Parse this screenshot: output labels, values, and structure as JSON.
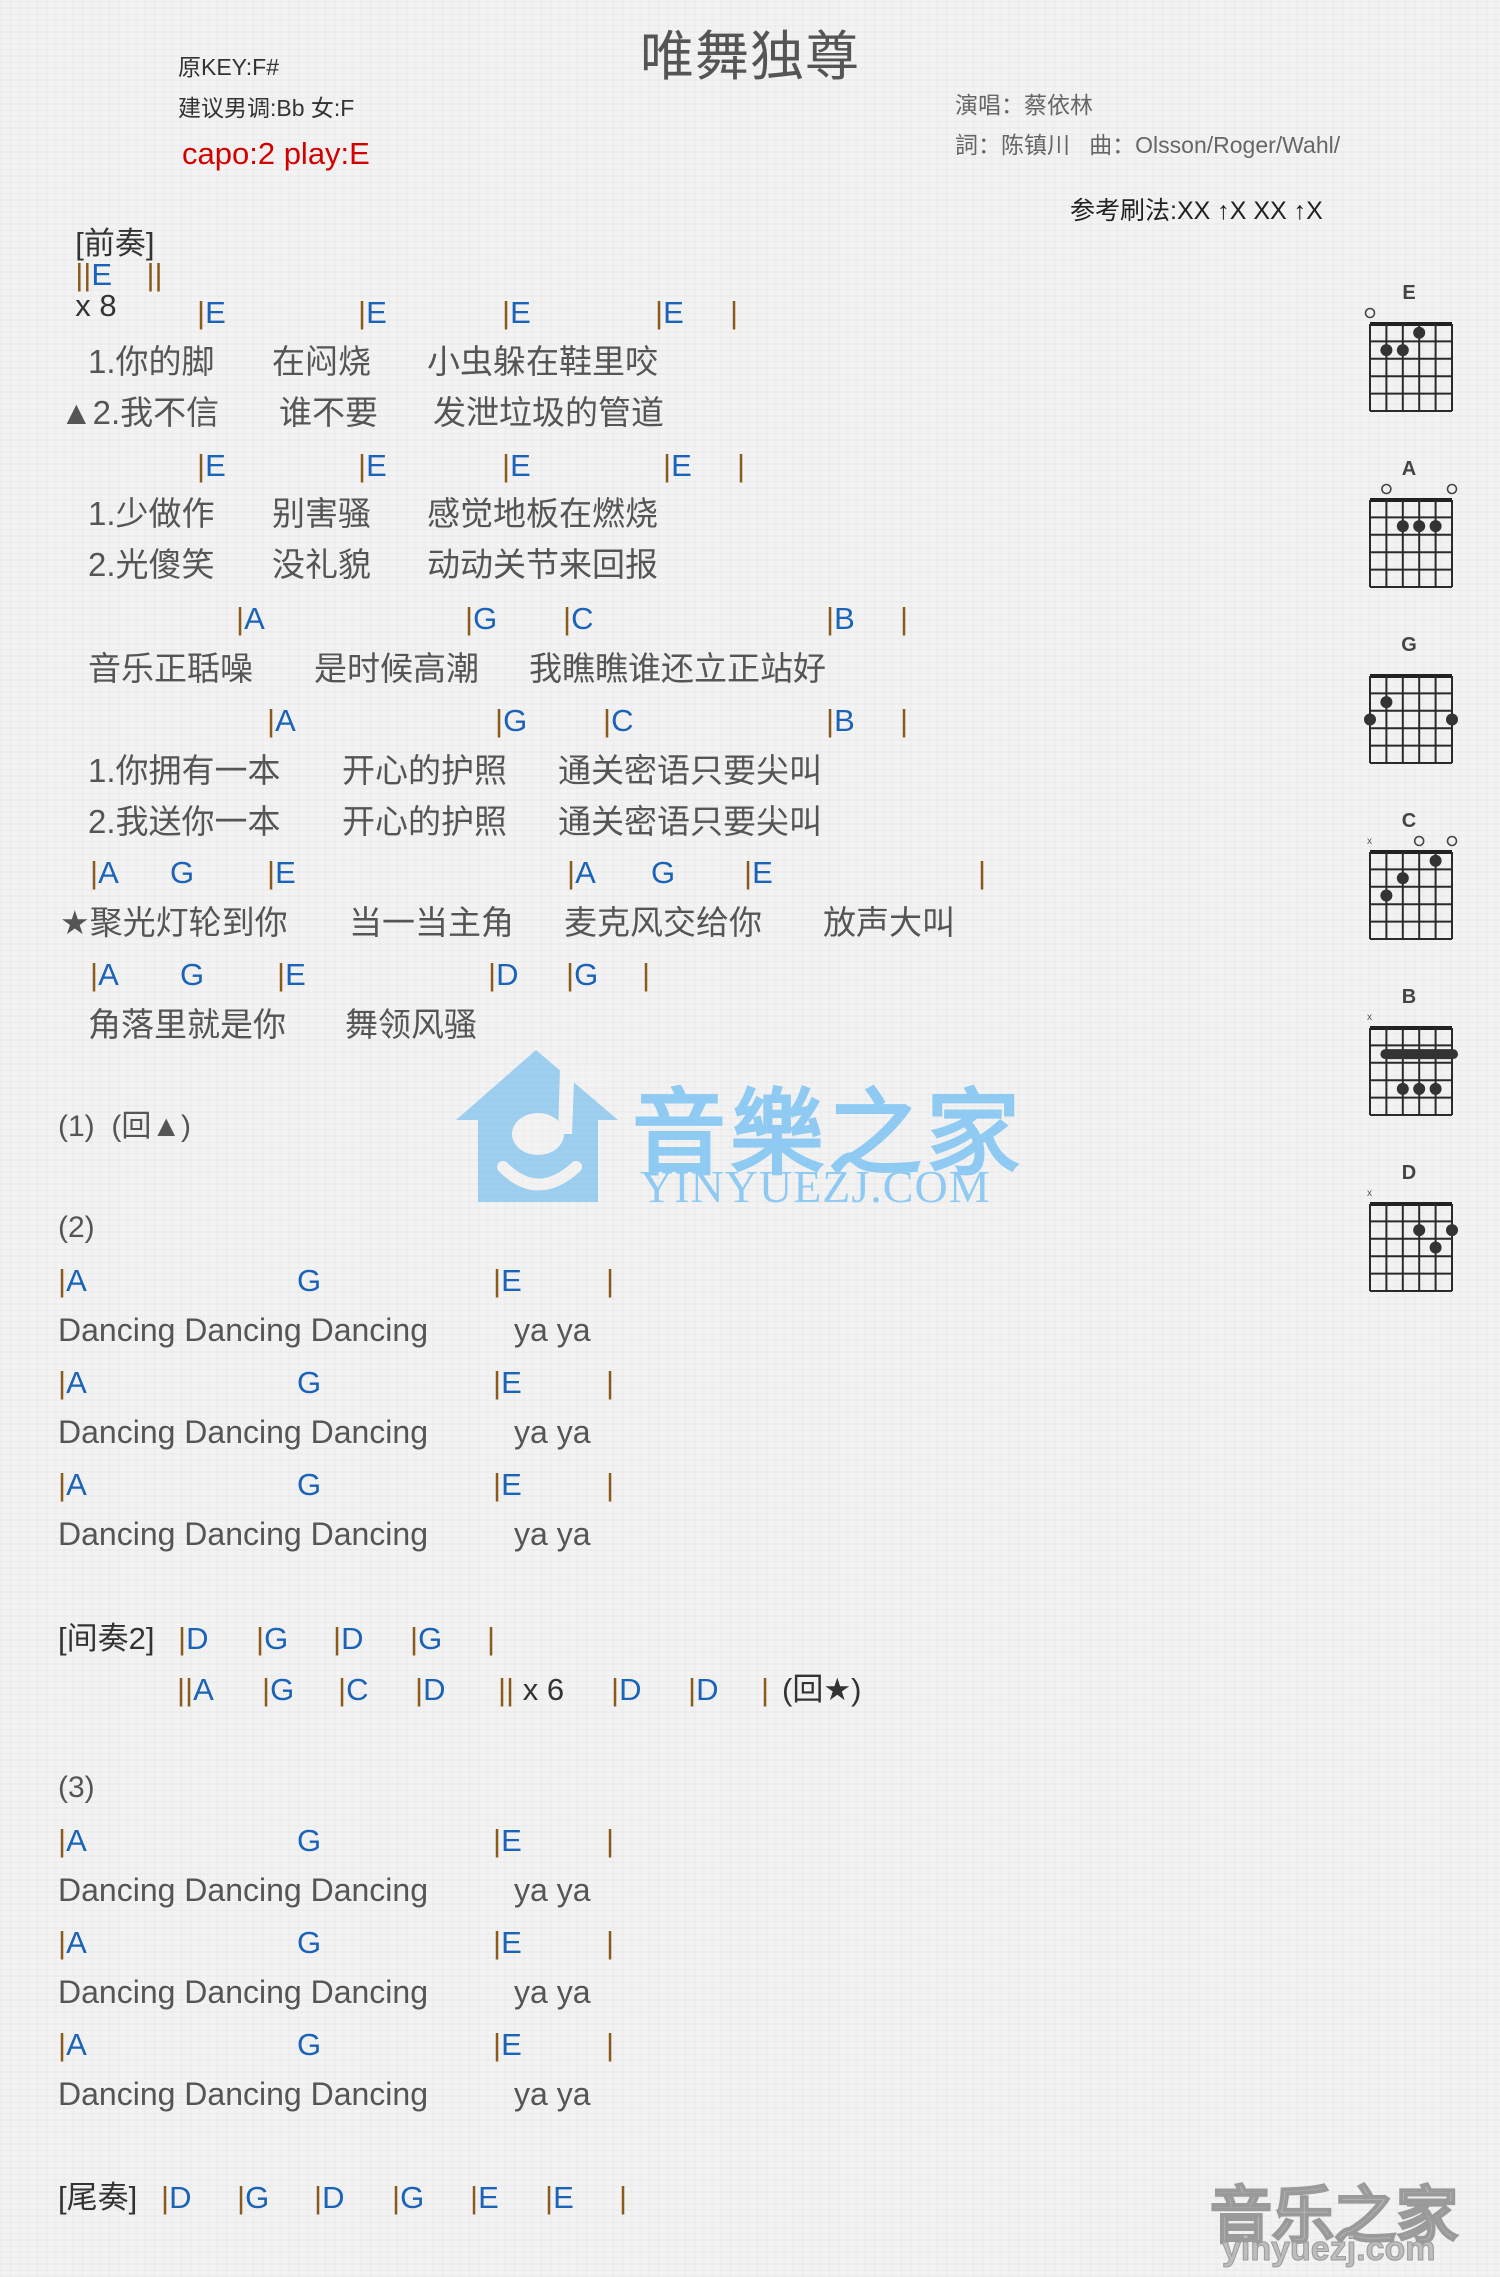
{
  "header": {
    "title": "唯舞独尊",
    "original_key": "原KEY:F#",
    "suggested_key": "建议男调:Bb 女:F",
    "capo": "capo:2 play:E",
    "singer": "演唱：蔡依林",
    "credits": "詞：陈镇川   曲：Olsson/Roger/Wahl/",
    "strum_pattern": "参考刷法:XX ↑X XX ↑X"
  },
  "intro": {
    "label": "[前奏]",
    "bar_open": "||",
    "chord": "E",
    "bar_close": "||",
    "repeat": "x 8"
  },
  "verse": {
    "chords1": [
      "|E",
      "|E",
      "|E",
      "|E",
      "|"
    ],
    "lyrics1a": [
      "1.你的脚",
      "在闷烧",
      "小虫躲在鞋里咬"
    ],
    "lyrics1b": [
      "▲2.我不信",
      "谁不要",
      "发泄垃圾的管道"
    ],
    "chords2": [
      "|E",
      "|E",
      "|E",
      "|E",
      "|"
    ],
    "lyrics2a": [
      "1.少做作",
      "别害骚",
      "感觉地板在燃烧"
    ],
    "lyrics2b": [
      "2.光傻笑",
      "没礼貌",
      "动动关节来回报"
    ],
    "chords3": [
      "|A",
      "|G",
      "|C",
      "|B",
      "|"
    ],
    "lyrics3": [
      "音乐正聒噪",
      "是时候高潮",
      "我瞧瞧谁还立正站好"
    ],
    "chords4": [
      "|A",
      "|G",
      "|C",
      "|B",
      "|"
    ],
    "lyrics4a": [
      "1.你拥有一本",
      "开心的护照",
      "通关密语只要尖叫"
    ],
    "lyrics4b": [
      "2.我送你一本",
      "开心的护照",
      "通关密语只要尖叫"
    ]
  },
  "chorus": {
    "chords1": [
      "|A",
      "G",
      "|E",
      "|A",
      "G",
      "|E",
      "|"
    ],
    "lyrics1": [
      "★聚光灯轮到你",
      "当一当主角",
      "麦克风交给你",
      "放声大叫"
    ],
    "chords2": [
      "|A",
      "G",
      "|E",
      "|D",
      "|G",
      "|"
    ],
    "lyrics2": [
      "角落里就是你",
      "舞领风骚"
    ]
  },
  "part1": {
    "label": "(1)",
    "note": "(回▲)"
  },
  "part2": {
    "label": "(2)",
    "lines": [
      {
        "chords": [
          "|A",
          "G",
          "|E",
          "|"
        ],
        "lyric": "Dancing Dancing Dancing",
        "tail": "ya ya"
      },
      {
        "chords": [
          "|A",
          "G",
          "|E",
          "|"
        ],
        "lyric": "Dancing Dancing Dancing",
        "tail": "ya ya"
      },
      {
        "chords": [
          "|A",
          "G",
          "|E",
          "|"
        ],
        "lyric": "Dancing Dancing Dancing",
        "tail": "ya ya"
      }
    ]
  },
  "interlude2": {
    "label": "[间奏2]",
    "row1": [
      "|D",
      "|G",
      "|D",
      "|G",
      "|"
    ],
    "row2": [
      "||A",
      "|G",
      "|C",
      "|D",
      "|| x 6",
      "|D",
      "|D",
      "|",
      "(回★)"
    ]
  },
  "part3": {
    "label": "(3)",
    "lines": [
      {
        "chords": [
          "|A",
          "G",
          "|E",
          "|"
        ],
        "lyric": "Dancing Dancing Dancing",
        "tail": "ya ya"
      },
      {
        "chords": [
          "|A",
          "G",
          "|E",
          "|"
        ],
        "lyric": "Dancing Dancing Dancing",
        "tail": "ya ya"
      },
      {
        "chords": [
          "|A",
          "G",
          "|E",
          "|"
        ],
        "lyric": "Dancing Dancing Dancing",
        "tail": "ya ya"
      }
    ]
  },
  "outro": {
    "label": "[尾奏]",
    "chords": [
      "|D",
      "|G",
      "|D",
      "|G",
      "|E",
      "|E",
      "|"
    ]
  },
  "chord_diagrams": [
    {
      "name": "E",
      "open": [
        0
      ],
      "muted": [],
      "dots": [
        [
          3,
          1
        ],
        [
          1,
          2
        ],
        [
          2,
          2
        ]
      ],
      "barre": null
    },
    {
      "name": "A",
      "open": [
        1,
        5
      ],
      "muted": [],
      "dots": [
        [
          2,
          2
        ],
        [
          3,
          2
        ],
        [
          4,
          2
        ]
      ],
      "barre": null
    },
    {
      "name": "G",
      "open": [],
      "muted": [],
      "dots": [
        [
          1,
          2
        ],
        [
          0,
          3
        ],
        [
          5,
          3
        ]
      ],
      "barre": null
    },
    {
      "name": "C",
      "open": [
        3,
        5
      ],
      "muted": [
        0
      ],
      "dots": [
        [
          4,
          1
        ],
        [
          2,
          2
        ],
        [
          1,
          3
        ]
      ],
      "barre": null
    },
    {
      "name": "B",
      "open": [],
      "muted": [
        0
      ],
      "dots": [
        [
          2,
          4
        ],
        [
          3,
          4
        ],
        [
          4,
          4
        ]
      ],
      "barre": 2
    },
    {
      "name": "D",
      "open": [],
      "muted": [
        0
      ],
      "dots": [
        [
          3,
          2
        ],
        [
          5,
          2
        ],
        [
          4,
          3
        ]
      ],
      "barre": null
    }
  ],
  "watermark": {
    "brand": "音樂之家",
    "url": "YINYUEZJ.COM",
    "corner_brand": "音乐之家",
    "corner_url": "yinyuezj.com"
  },
  "colors": {
    "chord": "#1a63b8",
    "bar": "#8a5a1a",
    "capo": "#d40000",
    "watermark": "#8fcaf3"
  }
}
